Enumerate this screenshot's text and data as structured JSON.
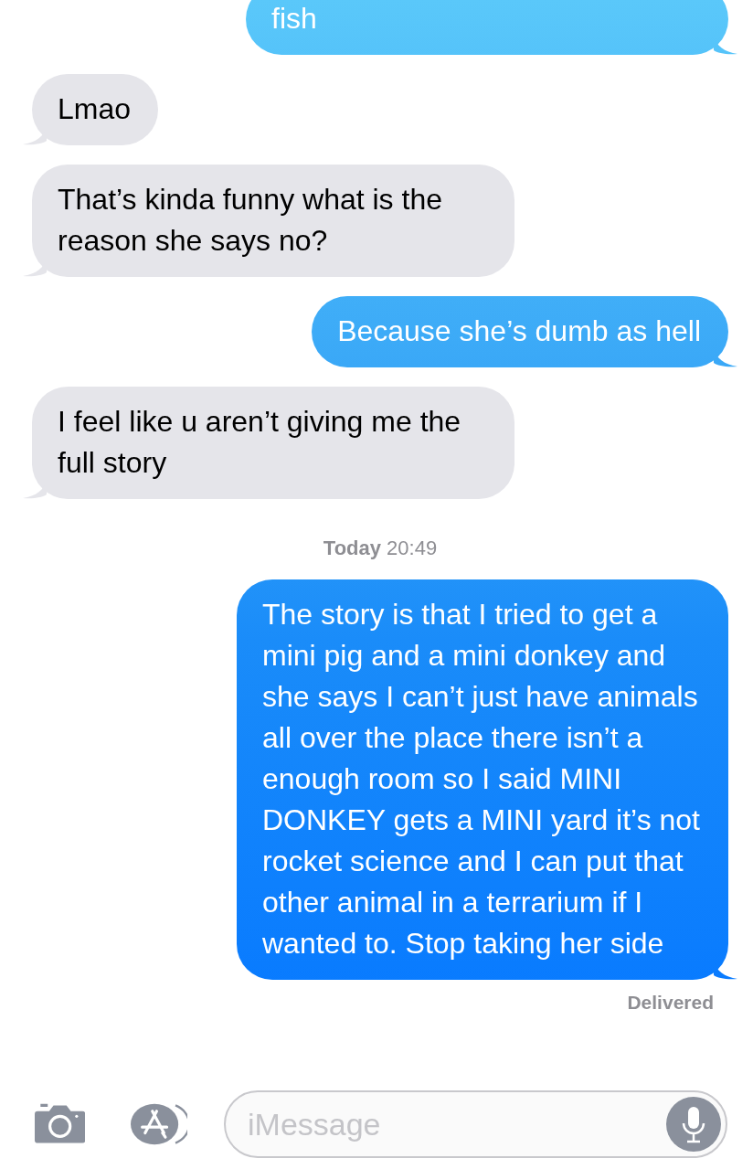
{
  "messages": [
    {
      "kind": "sent",
      "text": "fish"
    },
    {
      "kind": "received",
      "text": "Lmao"
    },
    {
      "kind": "received",
      "text": "That’s kinda funny what is the reason she says no?"
    },
    {
      "kind": "sent",
      "text": "Because she’s dumb as hell"
    },
    {
      "kind": "received",
      "text": "I feel like u aren’t giving me the full story"
    },
    {
      "kind": "timestamp",
      "text": "**Today** 20:49"
    },
    {
      "kind": "sent",
      "text": "The story is that I tried to get a mini pig and a mini donkey and she says I can’t just have animals all over the place there isn’t a enough room so I said MINI DONKEY gets a MINI yard it’s not rocket science and I can put that other animal in a terrarium if I wanted to. Stop taking her side"
    },
    {
      "kind": "status",
      "text": "Delivered"
    }
  ],
  "composer": {
    "placeholder": "iMessage"
  }
}
